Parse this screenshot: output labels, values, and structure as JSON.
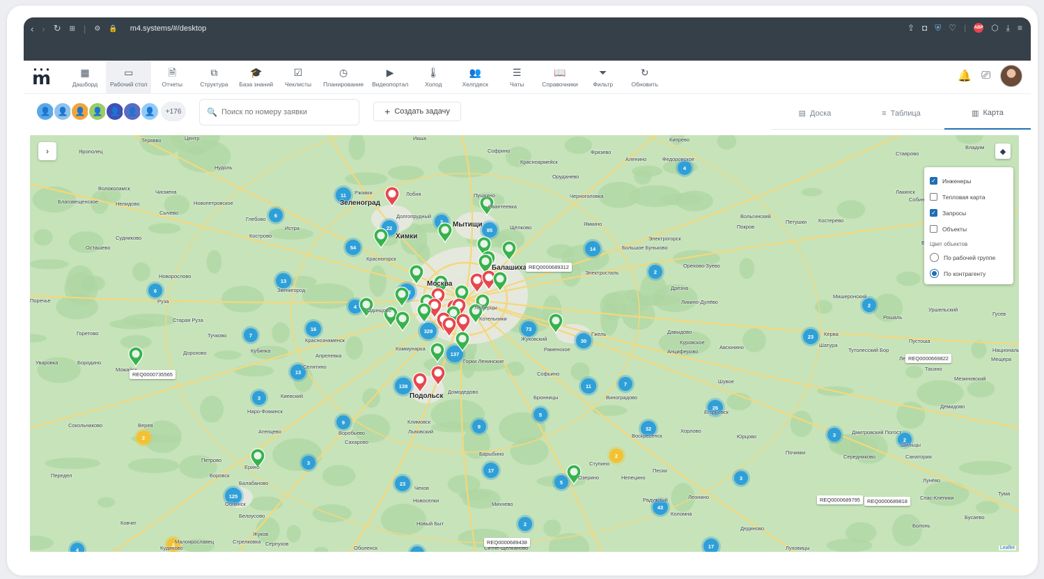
{
  "browser": {
    "url": "m4.systems/#/desktop",
    "abp": "ABP"
  },
  "logo": {
    "letter": "m"
  },
  "toolbar": {
    "items": [
      {
        "label": "Дашборд",
        "icon": "dashboard-icon",
        "glyph": "▦"
      },
      {
        "label": "Рабочий стол",
        "icon": "desktop-icon",
        "glyph": "▭"
      },
      {
        "label": "Отчеты",
        "icon": "report-icon",
        "glyph": "🗎"
      },
      {
        "label": "Структура",
        "icon": "structure-icon",
        "glyph": "⧉"
      },
      {
        "label": "База знаний",
        "icon": "graduation-cap-icon",
        "glyph": "🎓"
      },
      {
        "label": "Чеклисты",
        "icon": "checklist-icon",
        "glyph": "☑"
      },
      {
        "label": "Планирование",
        "icon": "clock-icon",
        "glyph": "◷"
      },
      {
        "label": "Видеопортал",
        "icon": "video-icon",
        "glyph": "▶"
      },
      {
        "label": "Холод",
        "icon": "thermometer-icon",
        "glyph": "🌡"
      },
      {
        "label": "Хелпдеск",
        "icon": "helpdesk-icon",
        "glyph": "👥"
      },
      {
        "label": "Чаты",
        "icon": "chat-icon",
        "glyph": "☰"
      },
      {
        "label": "Справочники",
        "icon": "book-icon",
        "glyph": "📖"
      },
      {
        "label": "Фильтр",
        "icon": "filter-icon",
        "glyph": "⏷"
      },
      {
        "label": "Обновить",
        "icon": "refresh-icon",
        "glyph": "↻"
      }
    ],
    "active": "Рабочий стол"
  },
  "filters": {
    "avatars_more": "+176",
    "search_placeholder": "Поиск по номеру заявки",
    "create_label": "Создать задачу",
    "views": [
      {
        "label": "Доска",
        "icon": "board-icon",
        "glyph": "▤"
      },
      {
        "label": "Таблица",
        "icon": "table-icon",
        "glyph": "≡"
      },
      {
        "label": "Карта",
        "icon": "map-icon",
        "glyph": "▥"
      }
    ],
    "active_view": "Карта"
  },
  "map": {
    "colors": {
      "land": "#c6e3ba",
      "land_dark": "#aed6a2",
      "urban": "#e8e8e1",
      "road": "#f5d77a",
      "cluster": "#2f9fd8",
      "cluster_yellow": "#f2c232",
      "pin_green": "#37b24d",
      "pin_red": "#e5484d"
    },
    "layers": {
      "options": [
        {
          "label": "Инженеры",
          "checked": true
        },
        {
          "label": "Тепловая карта",
          "checked": false
        },
        {
          "label": "Запросы",
          "checked": true
        },
        {
          "label": "Объекты",
          "checked": false
        }
      ],
      "color_section": "Цвет объектов",
      "color_options": [
        {
          "label": "По рабочей группе",
          "selected": false
        },
        {
          "label": "По контрагенту",
          "selected": true
        }
      ]
    },
    "attribution": "Leaflet",
    "places": [
      {
        "name": "Терявво"
      },
      {
        "name": "Центр"
      },
      {
        "name": "Икша"
      },
      {
        "name": "Софрино"
      },
      {
        "name": "Фрязево"
      },
      {
        "name": "Кипрево"
      },
      {
        "name": "Ставрово"
      },
      {
        "name": "Владим"
      },
      {
        "name": "Ярополец"
      },
      {
        "name": "Нудоль"
      },
      {
        "name": "Красноармейск"
      },
      {
        "name": "Аленино"
      },
      {
        "name": "Федоровское"
      },
      {
        "name": "Оруданево"
      },
      {
        "name": "Волоколамск"
      },
      {
        "name": "Чисмена"
      },
      {
        "name": "Ржавки"
      },
      {
        "name": "Лобня"
      },
      {
        "name": "Пушкино"
      },
      {
        "name": "Черноголовка"
      },
      {
        "name": "Лакинск"
      },
      {
        "name": "Собинка"
      },
      {
        "name": "Благовещенское"
      },
      {
        "name": "Нелидово"
      },
      {
        "name": "Новопетровское"
      },
      {
        "name": "Зеленоград",
        "big": true
      },
      {
        "name": "Долгопрудный"
      },
      {
        "name": "Ивантеевка"
      },
      {
        "name": "Ямкино"
      },
      {
        "name": "Вольгинский"
      },
      {
        "name": "Петушки"
      },
      {
        "name": "Костерево"
      },
      {
        "name": "Сычево"
      },
      {
        "name": "Глебово"
      },
      {
        "name": "Истра"
      },
      {
        "name": "Мытищи",
        "big": true
      },
      {
        "name": "Щёлково"
      },
      {
        "name": "Покров"
      },
      {
        "name": "Судниково"
      },
      {
        "name": "Кострово"
      },
      {
        "name": "Химки",
        "big": true
      },
      {
        "name": "Электрогорск"
      },
      {
        "name": "Осташево"
      },
      {
        "name": "Красногорск"
      },
      {
        "name": "Балашиха",
        "big": true
      },
      {
        "name": "Большое Буньково"
      },
      {
        "name": "Орехово-Зуево"
      },
      {
        "name": "Бере"
      },
      {
        "name": "Новорослово"
      },
      {
        "name": "Электросталь"
      },
      {
        "name": "Звенигород"
      },
      {
        "name": "Дрезна"
      },
      {
        "name": "Руза"
      },
      {
        "name": "Москва",
        "big": true
      },
      {
        "name": "Ликино-Дулёво"
      },
      {
        "name": "Мишеронский"
      },
      {
        "name": "Поречье"
      },
      {
        "name": "Одинцово"
      },
      {
        "name": "Старая Руза"
      },
      {
        "name": "Люберцы"
      },
      {
        "name": "Котельники"
      },
      {
        "name": "Рошаль"
      },
      {
        "name": "Уршельский"
      },
      {
        "name": "Гусев"
      },
      {
        "name": "Горетово"
      },
      {
        "name": "Тучково"
      },
      {
        "name": "Краснознаменск"
      },
      {
        "name": "Жуковский"
      },
      {
        "name": "Гжель"
      },
      {
        "name": "Давыдово"
      },
      {
        "name": "Куровское"
      },
      {
        "name": "Авсюнино"
      },
      {
        "name": "Анциферово"
      },
      {
        "name": "Керва"
      },
      {
        "name": "Шатура"
      },
      {
        "name": "Пустоша"
      },
      {
        "name": "Уваровка"
      },
      {
        "name": "Бородино"
      },
      {
        "name": "Можайск"
      },
      {
        "name": "Кубинка"
      },
      {
        "name": "Дорохово"
      },
      {
        "name": "Апрелевка"
      },
      {
        "name": "Коммунарка"
      },
      {
        "name": "Раменское"
      },
      {
        "name": "Тутолесский Бор"
      },
      {
        "name": "Лесни"
      },
      {
        "name": "Национальный"
      },
      {
        "name": "Мещера"
      },
      {
        "name": "Тасино"
      },
      {
        "name": "Селятино"
      },
      {
        "name": "Горки Ленинские"
      },
      {
        "name": "Софьино"
      },
      {
        "name": "Шувое"
      },
      {
        "name": "Мезиновский"
      },
      {
        "name": "Киевский"
      },
      {
        "name": "Подольск",
        "big": true
      },
      {
        "name": "Домодедово"
      },
      {
        "name": "Бронницы"
      },
      {
        "name": "Виноградово"
      },
      {
        "name": "Наро-Фоминск"
      },
      {
        "name": "Климовск"
      },
      {
        "name": "Львовский"
      },
      {
        "name": "Егорьевск"
      },
      {
        "name": "Демидово"
      },
      {
        "name": "Верея"
      },
      {
        "name": "Атепцево"
      },
      {
        "name": "Воробьево"
      },
      {
        "name": "Сахарово"
      },
      {
        "name": "Воскресенск"
      },
      {
        "name": "Хорлово"
      },
      {
        "name": "Юрцово"
      },
      {
        "name": "Дмитровский Погост"
      },
      {
        "name": "Шильцы"
      },
      {
        "name": "Сокольниково"
      },
      {
        "name": "Почикки"
      },
      {
        "name": "Середниково"
      },
      {
        "name": "Барыбино"
      },
      {
        "name": "Санатория"
      },
      {
        "name": "Петрово"
      },
      {
        "name": "Ерино"
      },
      {
        "name": "Ступино"
      },
      {
        "name": "Непецино"
      },
      {
        "name": "Пески"
      },
      {
        "name": "Передел"
      },
      {
        "name": "Боровск"
      },
      {
        "name": "Балабаново"
      },
      {
        "name": "Чехов"
      },
      {
        "name": "Озерино"
      },
      {
        "name": "Михнево"
      },
      {
        "name": "Радужный"
      },
      {
        "name": "Леонино"
      },
      {
        "name": "Лунёво"
      },
      {
        "name": "Обнинск"
      },
      {
        "name": "Белоусово"
      },
      {
        "name": "Новоселки"
      },
      {
        "name": "Рязань"
      },
      {
        "name": "Спас-Клепики"
      },
      {
        "name": "Тума"
      },
      {
        "name": "Ковчег"
      },
      {
        "name": "Новый Быт"
      },
      {
        "name": "Коломна"
      },
      {
        "name": "Бусаево"
      },
      {
        "name": "Жуков"
      },
      {
        "name": "Малоярославец"
      },
      {
        "name": "Стрелковка"
      },
      {
        "name": "Серпухов"
      },
      {
        "name": "Дединово"
      },
      {
        "name": "Болонь"
      },
      {
        "name": "Кудиново"
      },
      {
        "name": "Оболенск"
      },
      {
        "name": "Ситне-Щелканово"
      },
      {
        "name": "Луховицы"
      }
    ],
    "clusters": [
      {
        "count": "11"
      },
      {
        "count": "22"
      },
      {
        "count": "3"
      },
      {
        "count": "54"
      },
      {
        "count": "85"
      },
      {
        "count": "4"
      },
      {
        "count": "6"
      },
      {
        "count": "14"
      },
      {
        "count": "2"
      },
      {
        "count": "13"
      },
      {
        "count": "6"
      },
      {
        "count": "112"
      },
      {
        "count": "4"
      },
      {
        "count": "16"
      },
      {
        "count": "7"
      },
      {
        "count": "329"
      },
      {
        "count": "73"
      },
      {
        "count": "137"
      },
      {
        "count": "30"
      },
      {
        "count": "2"
      },
      {
        "count": "23"
      },
      {
        "count": "13"
      },
      {
        "count": "138"
      },
      {
        "count": "11"
      },
      {
        "count": "7"
      },
      {
        "count": "3"
      },
      {
        "count": "9"
      },
      {
        "count": "9"
      },
      {
        "count": "5"
      },
      {
        "count": "26"
      },
      {
        "count": "2",
        "yellow": true
      },
      {
        "count": "3"
      },
      {
        "count": "32"
      },
      {
        "count": "2",
        "yellow": true
      },
      {
        "count": "3"
      },
      {
        "count": "17"
      },
      {
        "count": "2"
      },
      {
        "count": "3"
      },
      {
        "count": "23"
      },
      {
        "count": "125"
      },
      {
        "count": "5"
      },
      {
        "count": "43"
      },
      {
        "count": "2"
      },
      {
        "count": "17"
      },
      {
        "count": "4"
      },
      {
        "count": "2",
        "yellow": true
      },
      {
        "count": "2"
      }
    ],
    "pins": [
      {
        "color": "red"
      },
      {
        "color": "green"
      },
      {
        "color": "green"
      },
      {
        "color": "green"
      },
      {
        "color": "green"
      },
      {
        "color": "green"
      },
      {
        "color": "green"
      },
      {
        "color": "green"
      },
      {
        "color": "green"
      },
      {
        "color": "red"
      },
      {
        "color": "red"
      },
      {
        "color": "green"
      },
      {
        "color": "green"
      },
      {
        "color": "green"
      },
      {
        "color": "red"
      },
      {
        "color": "red"
      },
      {
        "color": "green"
      },
      {
        "color": "green"
      },
      {
        "color": "red"
      },
      {
        "color": "green"
      },
      {
        "color": "red"
      },
      {
        "color": "green"
      },
      {
        "color": "green"
      },
      {
        "color": "green"
      },
      {
        "color": "green"
      },
      {
        "color": "green"
      },
      {
        "color": "red"
      },
      {
        "color": "red"
      },
      {
        "color": "green"
      },
      {
        "color": "red"
      },
      {
        "color": "green"
      },
      {
        "color": "green"
      },
      {
        "color": "green"
      },
      {
        "color": "red"
      },
      {
        "color": "green"
      },
      {
        "color": "green"
      },
      {
        "color": "red"
      },
      {
        "color": "green"
      }
    ],
    "tags": [
      {
        "label": "REQ0000689312"
      },
      {
        "label": "REQ0000735565"
      },
      {
        "label": "REQ0000669822"
      },
      {
        "label": "REQ0000689795"
      },
      {
        "label": "REQ0000689818"
      },
      {
        "label": "REQ0000689438"
      }
    ]
  }
}
